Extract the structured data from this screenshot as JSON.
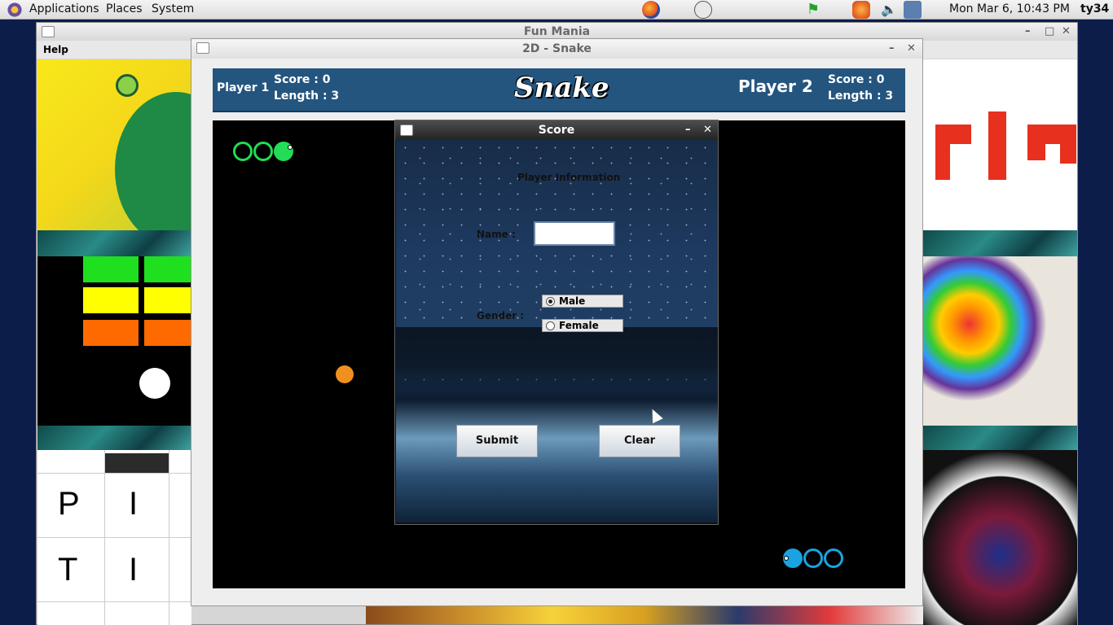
{
  "panel": {
    "applications": "Applications",
    "places": "Places",
    "system": "System",
    "datetime": "Mon Mar  6, 10:43 PM",
    "user": "ty34"
  },
  "fun_mania": {
    "title": "Fun Mania",
    "menu_help": "Help",
    "tiles": {
      "tic_letters": [
        "P",
        "I",
        "T",
        "I"
      ]
    }
  },
  "snake": {
    "title": "2D - Snake",
    "logo": "Snake",
    "player1": {
      "name": "Player 1",
      "score": "Score : 0",
      "length": "Length : 3"
    },
    "player2": {
      "name": "Player 2",
      "score": "Score : 0",
      "length": "Length : 3"
    },
    "colors": {
      "p1": "#22dd55",
      "p2": "#1aa3e0",
      "food": "#f0901e",
      "header": "#24557f"
    }
  },
  "score_dialog": {
    "title": "Score",
    "heading": "Player Information",
    "name_label": "Name :",
    "name_value": "",
    "gender_label": "Gender :",
    "gender_options": [
      "Male",
      "Female"
    ],
    "gender_selected": "Male",
    "submit": "Submit",
    "clear": "Clear"
  }
}
